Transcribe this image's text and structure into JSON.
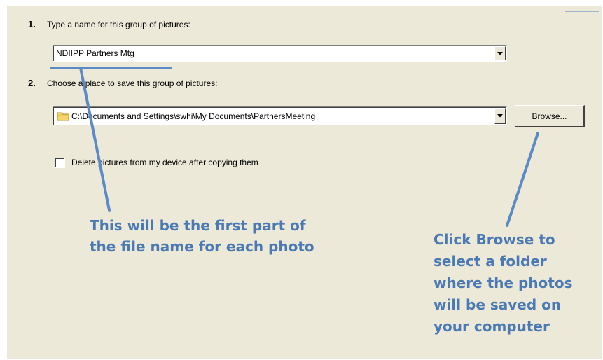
{
  "step1": {
    "number": "1.",
    "label": "Type a name for this group of pictures:",
    "value": "NDIIPP Partners Mtg"
  },
  "step2": {
    "number": "2.",
    "label": "Choose a place to save this group of pictures:",
    "value": "C:\\Documents and Settings\\swhi\\My Documents\\PartnersMeeting",
    "browse_label": "Browse..."
  },
  "delete_option": {
    "label": "Delete pictures from my device after copying them",
    "checked": false
  },
  "annotations": {
    "name_callout": [
      "This will be the first part of",
      "the file name for each photo"
    ],
    "browse_callout": [
      "Click Browse to",
      "select a folder",
      "where the photos",
      "will be saved on",
      "your computer"
    ]
  },
  "icons": {
    "dropdown": "chevron-down-icon",
    "folder": "folder-icon"
  },
  "colors": {
    "dialog_bg": "#ece9d8",
    "annotation": "#4a79b4",
    "folder": "#f5d46e"
  }
}
